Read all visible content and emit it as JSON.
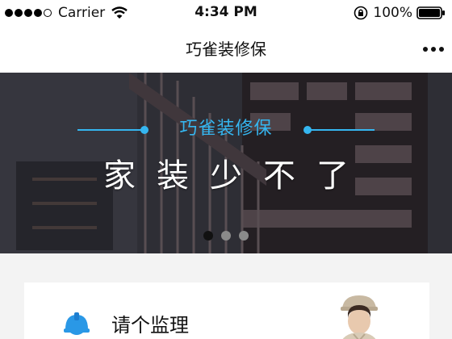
{
  "status_bar": {
    "carrier": "Carrier",
    "time": "4:34 PM",
    "battery": "100%"
  },
  "nav": {
    "title": "巧雀装修保"
  },
  "banner": {
    "subtitle": "巧雀装修保",
    "title": "家装少不了",
    "pager": {
      "count": 3,
      "active_index": 0
    }
  },
  "card": {
    "label": "请个监理"
  },
  "colors": {
    "accent": "#35b6f0",
    "banner_bg": "#2f3036",
    "page_bg": "#f3f3f3"
  },
  "icons": [
    "signal-dots-icon",
    "wifi-icon",
    "lock-rotation-icon",
    "battery-icon",
    "more-icon",
    "hardhat-icon"
  ]
}
